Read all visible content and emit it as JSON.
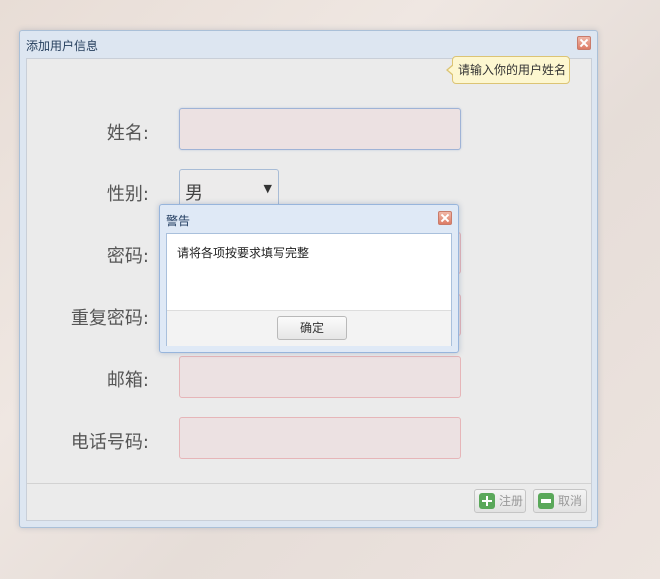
{
  "window": {
    "title": "添加用户信息"
  },
  "form": {
    "name_label": "姓名:",
    "gender_label": "性别:",
    "gender_value": "男",
    "password_label": "密码:",
    "repeat_password_label": "重复密码:",
    "email_label": "邮箱:",
    "phone_label": "电话号码:"
  },
  "tooltip": {
    "text": "请输入你的用户姓名"
  },
  "footer": {
    "register_label": "注册",
    "cancel_label": "取消"
  },
  "alert": {
    "title": "警告",
    "message": "请将各项按要求填写完整",
    "ok_label": "确定"
  },
  "colors": {
    "window_border": "#aac0d8",
    "field_invalid_bg": "#ece1e2",
    "field_invalid_border": "#e6b5b8",
    "tooltip_bg": "#fdf7d0",
    "icon_green": "#5aa85a",
    "close_red": "#dd7c66"
  }
}
